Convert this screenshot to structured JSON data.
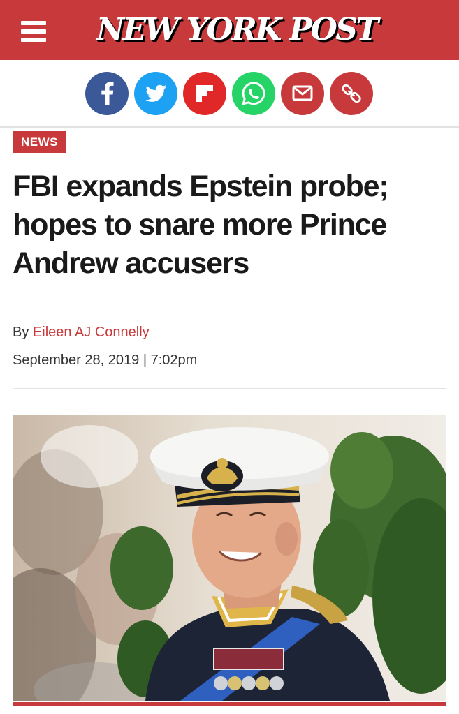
{
  "header": {
    "logo_text": "NEW YORK POST",
    "brand_color": "#c8393b",
    "menu_icon": "hamburger-menu-icon"
  },
  "share_buttons": [
    {
      "name": "facebook",
      "icon": "facebook-icon",
      "color": "#3b5998"
    },
    {
      "name": "twitter",
      "icon": "twitter-bird-icon",
      "color": "#1da1f2"
    },
    {
      "name": "flipboard",
      "icon": "flipboard-icon",
      "color": "#e12828"
    },
    {
      "name": "whatsapp",
      "icon": "whatsapp-icon",
      "color": "#25d366"
    },
    {
      "name": "email",
      "icon": "envelope-icon",
      "color": "#c8393b"
    },
    {
      "name": "copy-link",
      "icon": "link-chain-icon",
      "color": "#c8393b"
    }
  ],
  "article": {
    "section_badge": "NEWS",
    "headline": "FBI expands Epstein probe; hopes to snare more Prince Andrew accusers",
    "byline_prefix": "By",
    "author": "Eileen AJ Connelly",
    "date": "September 28, 2019",
    "date_separator": "|",
    "time": "7:02pm"
  }
}
